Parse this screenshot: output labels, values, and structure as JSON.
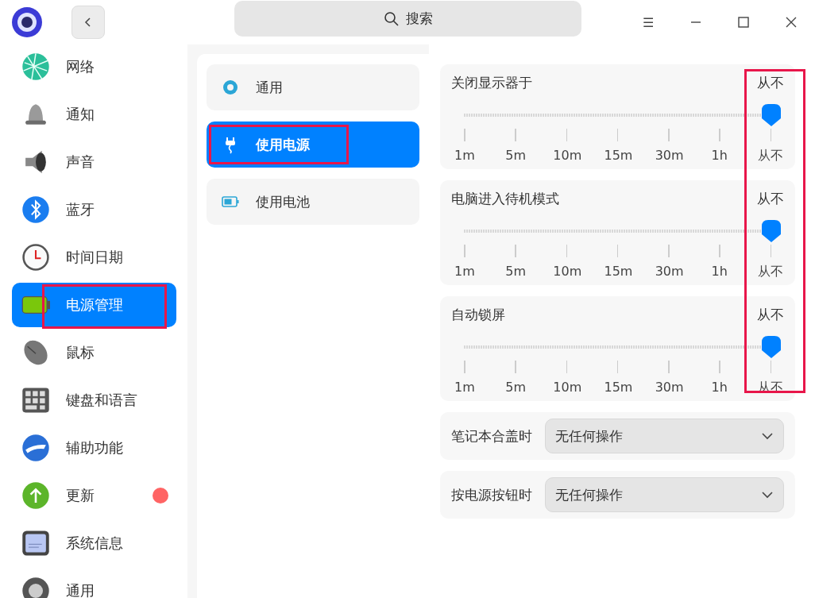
{
  "header": {
    "search": {
      "placeholder": "搜索"
    },
    "menu_glyph": "☰"
  },
  "sidebar": {
    "items": [
      {
        "label": "网络",
        "selected": false,
        "annotated": false,
        "notification_dot": false
      },
      {
        "label": "通知",
        "selected": false,
        "annotated": false,
        "notification_dot": false
      },
      {
        "label": "声音",
        "selected": false,
        "annotated": false,
        "notification_dot": false
      },
      {
        "label": "蓝牙",
        "selected": false,
        "annotated": false,
        "notification_dot": false
      },
      {
        "label": "时间日期",
        "selected": false,
        "annotated": false,
        "notification_dot": false
      },
      {
        "label": "电源管理",
        "selected": true,
        "annotated": true,
        "notification_dot": false
      },
      {
        "label": "鼠标",
        "selected": false,
        "annotated": false,
        "notification_dot": false
      },
      {
        "label": "键盘和语言",
        "selected": false,
        "annotated": false,
        "notification_dot": false
      },
      {
        "label": "辅助功能",
        "selected": false,
        "annotated": false,
        "notification_dot": false
      },
      {
        "label": "更新",
        "selected": false,
        "annotated": false,
        "notification_dot": true
      },
      {
        "label": "系统信息",
        "selected": false,
        "annotated": false,
        "notification_dot": false
      },
      {
        "label": "通用",
        "selected": false,
        "annotated": false,
        "notification_dot": false
      }
    ]
  },
  "subnav": {
    "items": [
      {
        "label": "通用",
        "selected": false,
        "annotated": false
      },
      {
        "label": "使用电源",
        "selected": true,
        "annotated": true
      },
      {
        "label": "使用电池",
        "selected": false,
        "annotated": false
      }
    ]
  },
  "settings": {
    "sliders_annotated": true,
    "sliders": [
      {
        "title": "关闭显示器于",
        "value": "从不",
        "level": 1,
        "ticks": [
          "1m",
          "5m",
          "10m",
          "15m",
          "30m",
          "1h",
          "从不"
        ]
      },
      {
        "title": "电脑进入待机模式",
        "value": "从不",
        "level": 1,
        "ticks": [
          "1m",
          "5m",
          "10m",
          "15m",
          "30m",
          "1h",
          "从不"
        ]
      },
      {
        "title": "自动锁屏",
        "value": "从不",
        "level": 1,
        "ticks": [
          "1m",
          "5m",
          "10m",
          "15m",
          "30m",
          "1h",
          "从不"
        ]
      }
    ],
    "dropdowns": [
      {
        "label": "笔记本合盖时",
        "value": "无任何操作"
      },
      {
        "label": "按电源按钮时",
        "value": "无任何操作"
      }
    ]
  }
}
